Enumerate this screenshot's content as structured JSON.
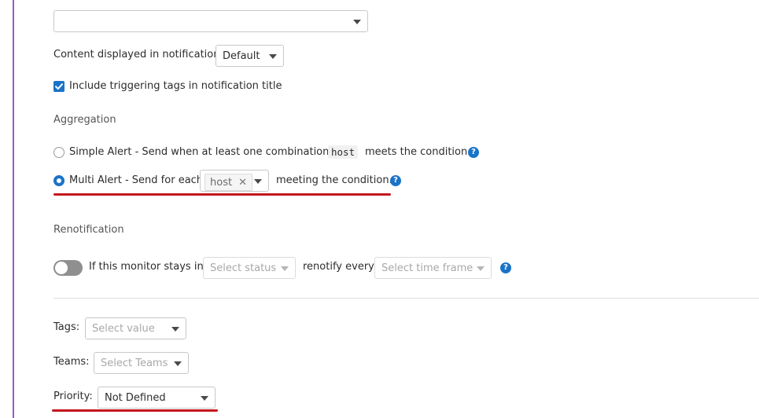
{
  "top_select": {
    "value": ""
  },
  "content_notification": {
    "label": "Content displayed in notification",
    "value": "Default"
  },
  "include_tags": {
    "label": "Include triggering tags in notification title",
    "checked": true
  },
  "aggregation": {
    "heading": "Aggregation",
    "simple_alert": {
      "text_before": "Simple Alert - Send when at least one combination of",
      "code": "host",
      "text_after": "meets the condition.",
      "selected": false
    },
    "multi_alert": {
      "text_before": "Multi Alert - Send for each",
      "tag": "host",
      "text_after": "meeting the condition.",
      "selected": true
    }
  },
  "renotification": {
    "heading": "Renotification",
    "toggle_on": false,
    "text_before": "If this monitor stays in",
    "status_placeholder": "Select status",
    "text_middle": "renotify every",
    "timeframe_placeholder": "Select time frame"
  },
  "tags": {
    "label": "Tags:",
    "placeholder": "Select value"
  },
  "teams": {
    "label": "Teams:",
    "placeholder": "Select Teams"
  },
  "priority": {
    "label": "Priority:",
    "value": "Not Defined"
  },
  "colors": {
    "accent": "#1a73c9",
    "highlight_underline": "#c4161c",
    "left_border": "#9b59c9"
  },
  "icons": {
    "help": "question-circle-icon",
    "checkbox": "check-icon",
    "tag_remove": "close-icon"
  }
}
